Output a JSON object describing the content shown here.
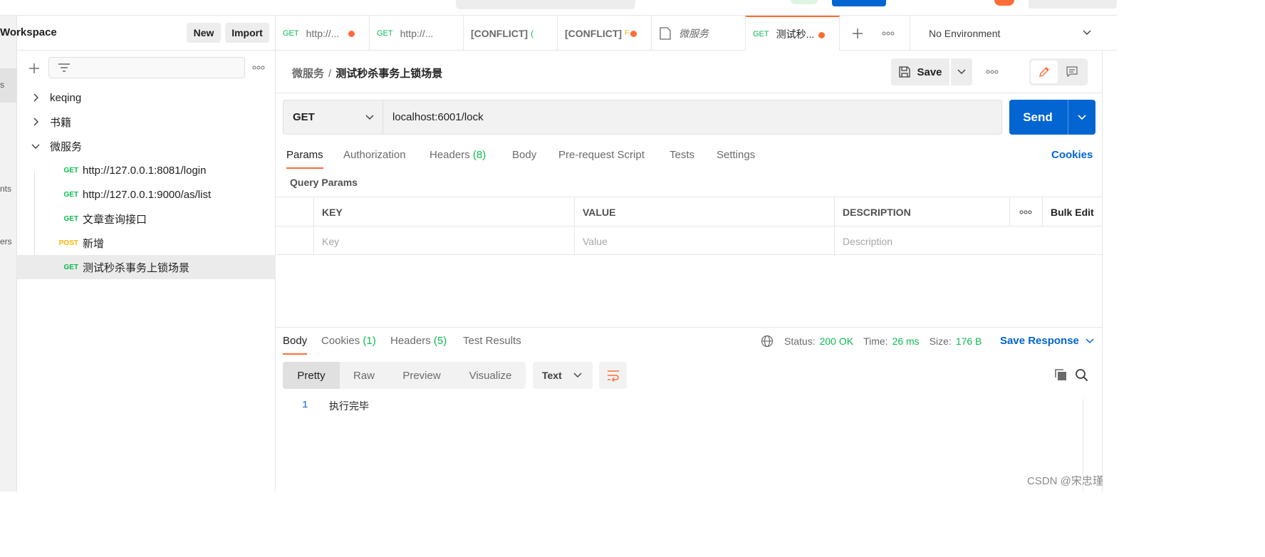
{
  "sidebar": {
    "title": "Workspace",
    "new_label": "New",
    "import_label": "Import",
    "rail_labels": [
      "s",
      "nts",
      "ers"
    ],
    "tree": [
      {
        "label": "keqing",
        "type": "folder",
        "expanded": false
      },
      {
        "label": "书籍",
        "type": "folder",
        "expanded": false
      },
      {
        "label": "微服务",
        "type": "folder",
        "expanded": true
      },
      {
        "method": "GET",
        "label": "http://127.0.0.1:8081/login"
      },
      {
        "method": "GET",
        "label": "http://127.0.0.1:9000/as/list"
      },
      {
        "method": "GET",
        "label": "文章查询接口"
      },
      {
        "method": "POST",
        "label": "新增"
      },
      {
        "method": "GET",
        "label": "测试秒杀事务上锁场景",
        "selected": true
      }
    ]
  },
  "tabs": [
    {
      "method": "GET",
      "label": "http://..."
    },
    {
      "method": "GET",
      "label": "http://..."
    },
    {
      "label": "[CONFLICT]"
    },
    {
      "label": "[CONFLICT]"
    },
    {
      "label": "微服务"
    },
    {
      "method": "GET",
      "label": "测试秒..."
    }
  ],
  "environment": "No Environment",
  "request": {
    "breadcrumb_parent": "微服务",
    "breadcrumb_sep": "/",
    "breadcrumb_current": "测试秒杀事务上锁场景",
    "save_label": "Save",
    "method": "GET",
    "url": "localhost:6001/lock",
    "send_label": "Send",
    "tabs": {
      "params": "Params",
      "authorization": "Authorization",
      "headers": "Headers",
      "headers_count": "(8)",
      "body": "Body",
      "prerequest": "Pre-request Script",
      "tests": "Tests",
      "settings": "Settings"
    },
    "cookies_label": "Cookies",
    "query_params_title": "Query Params",
    "table": {
      "key_header": "KEY",
      "value_header": "VALUE",
      "description_header": "DESCRIPTION",
      "bulk_edit": "Bulk Edit",
      "key_placeholder": "Key",
      "value_placeholder": "Value",
      "description_placeholder": "Description"
    }
  },
  "response": {
    "tabs": {
      "body": "Body",
      "cookies": "Cookies",
      "cookies_count": "(1)",
      "headers": "Headers",
      "headers_count": "(5)",
      "test_results": "Test Results"
    },
    "status_label": "Status:",
    "status_value": "200 OK",
    "time_label": "Time:",
    "time_value": "26 ms",
    "size_label": "Size:",
    "size_value": "176 B",
    "save_response": "Save Response",
    "formats": [
      "Pretty",
      "Raw",
      "Preview",
      "Visualize"
    ],
    "text_format": "Text",
    "line_number": "1",
    "body_text": "执行完毕"
  },
  "watermark": "CSDN @宋忠瑾",
  "colors": {
    "accent": "#ff6c37",
    "primary": "#0265d2",
    "success": "#0cbb52",
    "post": "#ffb400"
  }
}
